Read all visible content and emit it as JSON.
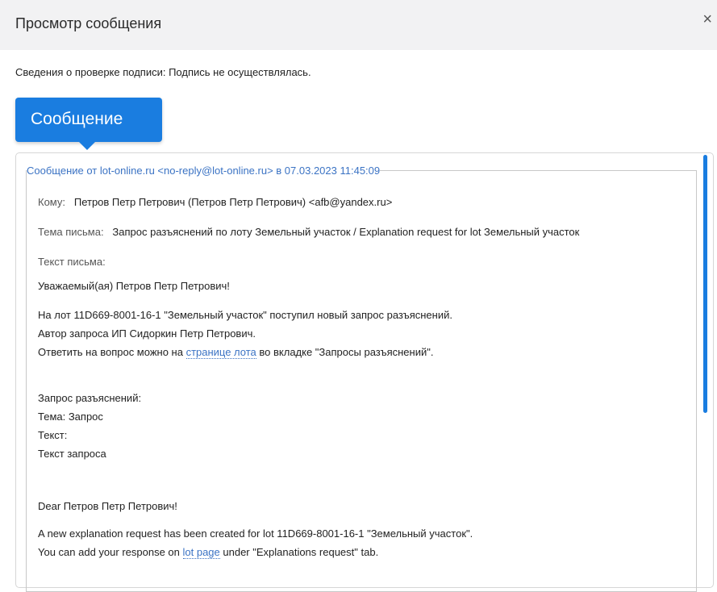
{
  "dialog": {
    "title": "Просмотр сообщения",
    "close_glyph": "×"
  },
  "signature": {
    "text": "Сведения о проверке подписи: Подпись не осуществлялась."
  },
  "tab": {
    "label": "Сообщение"
  },
  "message": {
    "legend": "Сообщение от lot-online.ru <no-reply@lot-online.ru> в 07.03.2023 11:45:09",
    "to_label": "Кому:",
    "to_value": "Петров Петр Петрович (Петров Петр Петрович) <afb@yandex.ru>",
    "subject_label": "Тема письма:",
    "subject_value": "Запрос разъяснений по лоту Земельный участок / Explanation request for lot Земельный участок",
    "body_label": "Текст письма:",
    "greeting_ru": "Уважаемый(ая) Петров Петр Петрович!",
    "ru_line1": "На лот 11D669-8001-16-1 \"Земельный участок\" поступил новый запрос разъяснений.",
    "ru_line2": "Автор запроса ИП Сидоркин Петр Петрович.",
    "ru_line3_before": "Ответить на вопрос можно на ",
    "ru_line3_link": "странице лота",
    "ru_line3_after": " во вкладке \"Запросы разъяснений\".",
    "req_header": "Запрос разъяснений:",
    "req_subject": "Тема: Запрос",
    "req_text_label": "Текст:",
    "req_text": "Текст запроса",
    "greeting_en": "Dear Петров Петр Петрович!",
    "en_line1": "A new explanation request has been created for lot 11D669-8001-16-1 \"Земельный участок\".",
    "en_line2_before": "You can add your response on ",
    "en_line2_link": "lot page",
    "en_line2_after": " under \"Explanations request\" tab."
  },
  "colors": {
    "accent": "#1a7de0",
    "link": "#3b73c4",
    "header_bg": "#f2f2f3"
  }
}
